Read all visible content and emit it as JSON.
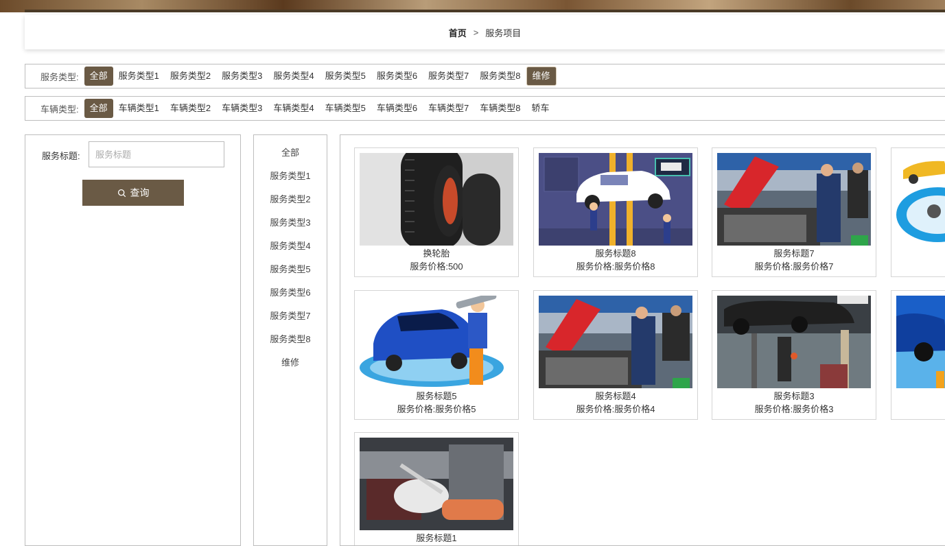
{
  "breadcrumb": {
    "home": "首页",
    "separator": ">",
    "current": "服务项目"
  },
  "service_filter": {
    "label": "服务类型:",
    "options": [
      "全部",
      "服务类型1",
      "服务类型2",
      "服务类型3",
      "服务类型4",
      "服务类型5",
      "服务类型6",
      "服务类型7",
      "服务类型8",
      "维修"
    ],
    "active": "全部",
    "hovered": "维修"
  },
  "vehicle_filter": {
    "label": "车辆类型:",
    "options": [
      "全部",
      "车辆类型1",
      "车辆类型2",
      "车辆类型3",
      "车辆类型4",
      "车辆类型5",
      "车辆类型6",
      "车辆类型7",
      "车辆类型8",
      "轿车"
    ],
    "active": "全部"
  },
  "search": {
    "label": "服务标题:",
    "placeholder": "服务标题",
    "value": "",
    "button_label": "查询",
    "button_icon": "search-icon"
  },
  "categories": [
    "全部",
    "服务类型1",
    "服务类型2",
    "服务类型3",
    "服务类型4",
    "服务类型5",
    "服务类型6",
    "服务类型7",
    "服务类型8",
    "维修"
  ],
  "colors": {
    "accent": "#6a5a45",
    "border": "#bdbdbd"
  },
  "cards": [
    {
      "title": "换轮胎",
      "price": "服务价格:500",
      "image": "tires-photo"
    },
    {
      "title": "服务标题8",
      "price": "服务价格:服务价格8",
      "image": "car-lift-illustration"
    },
    {
      "title": "服务标题7",
      "price": "服务价格:服务价格7",
      "image": "mechanic-engine-photo"
    },
    {
      "title": "",
      "price": "",
      "image": "yellow-car-illustration"
    },
    {
      "title": "服务标题5",
      "price": "服务价格:服务价格5",
      "image": "blue-car-mechanic-illustration"
    },
    {
      "title": "服务标题4",
      "price": "服务价格:服务价格4",
      "image": "mechanic-engine-photo"
    },
    {
      "title": "服务标题3",
      "price": "服务价格:服务价格3",
      "image": "car-on-lift-photo"
    },
    {
      "title": "",
      "price": "",
      "image": "blue-car-illustration"
    },
    {
      "title": "服务标题1",
      "price": "",
      "image": "engine-repair-photo"
    }
  ]
}
